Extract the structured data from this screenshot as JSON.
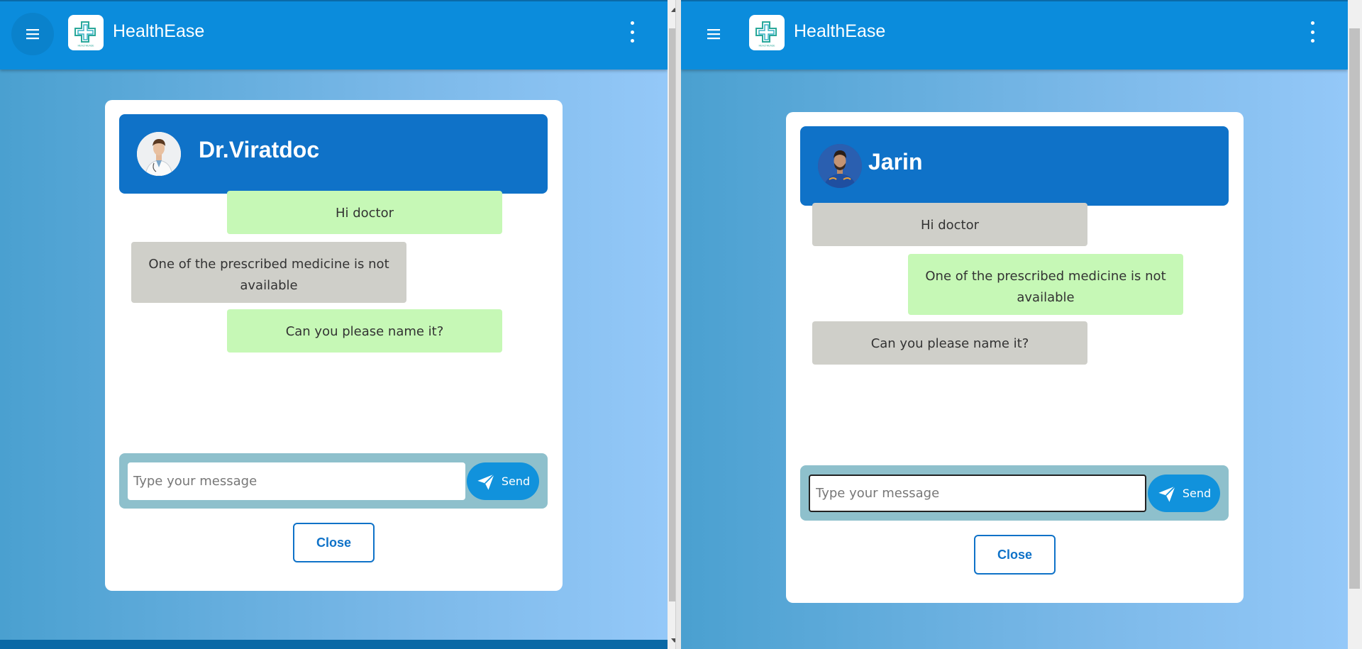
{
  "app": {
    "brand": "HealthEase",
    "logo_caption": "HEALTHEASE"
  },
  "doctor_view": {
    "contact_name": "Dr.Viratdoc",
    "messages": [
      {
        "text": "Hi doctor",
        "side": "sent"
      },
      {
        "text": "One of the prescribed medicine is not available",
        "side": "received"
      },
      {
        "text": "Can you please name it?",
        "side": "sent"
      }
    ],
    "composer": {
      "placeholder": "Type your message",
      "value": "",
      "send_label": "Send"
    },
    "close_label": "Close"
  },
  "patient_view": {
    "contact_name": "Jarin",
    "messages": [
      {
        "text": "Hi doctor",
        "side": "received"
      },
      {
        "text": "One of the prescribed medicine is not available",
        "side": "sent"
      },
      {
        "text": "Can you please name it?",
        "side": "received"
      }
    ],
    "composer": {
      "placeholder": "Type your message",
      "value": "",
      "send_label": "Send"
    },
    "close_label": "Close"
  },
  "colors": {
    "appbar": "#0b8cdc",
    "chat_header": "#0f72c8",
    "sent_bubble": "#c6f8b6",
    "received_bubble": "#cfcfc9",
    "composer_bar": "#8ec0cc",
    "send_button": "#1192dc"
  },
  "icons": [
    "menu-icon",
    "healthease-logo",
    "more-vert-icon",
    "send-icon",
    "avatar"
  ]
}
